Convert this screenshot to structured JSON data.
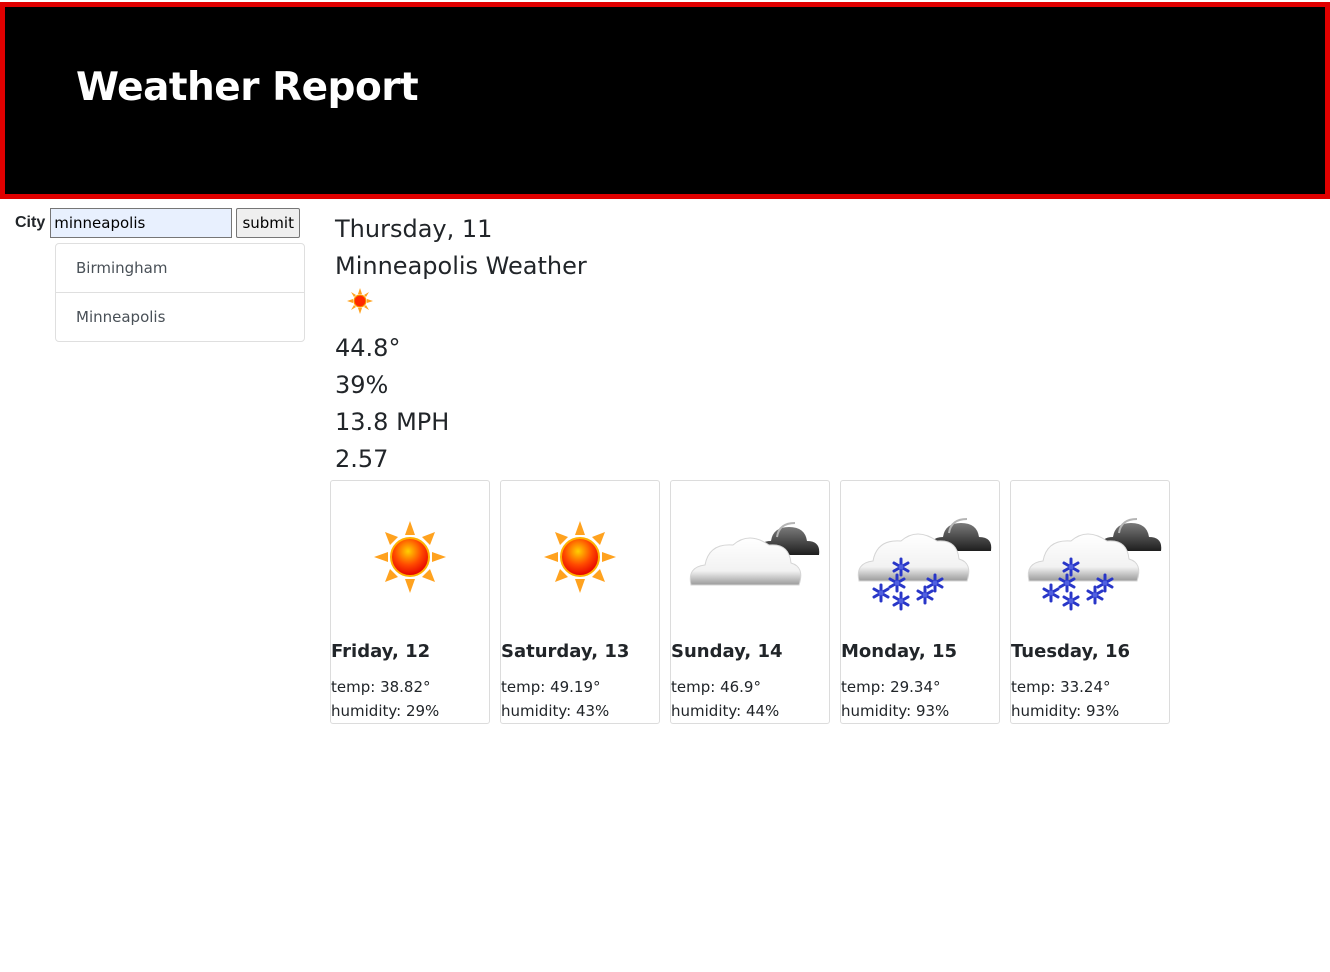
{
  "header": {
    "title": "Weather Report"
  },
  "search": {
    "label": "City",
    "value": "minneapolis",
    "submit_label": "submit"
  },
  "history": [
    {
      "label": "Birmingham"
    },
    {
      "label": "Minneapolis"
    }
  ],
  "current": {
    "date": "Thursday, 11",
    "heading": "Minneapolis Weather",
    "icon": "sunny-icon",
    "temperature": "44.8°",
    "humidity": "39%",
    "wind": "13.8 MPH",
    "uv_index": "2.57"
  },
  "forecast": [
    {
      "day": "Friday, 12",
      "icon": "sunny-icon",
      "temp": "temp: 38.82°",
      "humidity": "humidity: 29%"
    },
    {
      "day": "Saturday, 13",
      "icon": "sunny-icon",
      "temp": "temp: 49.19°",
      "humidity": "humidity: 43%"
    },
    {
      "day": "Sunday, 14",
      "icon": "cloudy-icon",
      "temp": "temp: 46.9°",
      "humidity": "humidity: 44%"
    },
    {
      "day": "Monday, 15",
      "icon": "snow-icon",
      "temp": "temp: 29.34°",
      "humidity": "humidity: 93%"
    },
    {
      "day": "Tuesday, 16",
      "icon": "snow-icon",
      "temp": "temp: 33.24°",
      "humidity": "humidity: 93%"
    }
  ],
  "colors": {
    "header_bg": "#000000",
    "header_border": "#e00000",
    "sun": "#ff2a00",
    "sun_rays": "#ffa21f",
    "snow": "#2836c8"
  }
}
